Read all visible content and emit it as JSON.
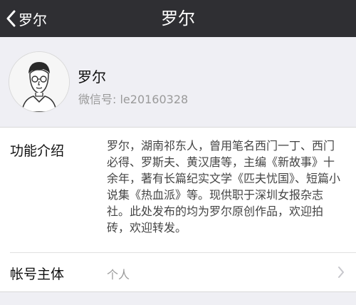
{
  "navbar": {
    "back_label": "罗尔",
    "title": "罗尔",
    "background": "#2f2f33"
  },
  "profile": {
    "name": "罗尔",
    "wechat_id": "微信号: le20160328",
    "avatar_icon": "cartoon-portrait-avatar"
  },
  "info": {
    "intro_label": "功能介绍",
    "intro_text": "罗尔，湖南祁东人，曾用笔名西门一丁、西门必得、罗斯夫、黄汉唐等，主编《新故事》十余年，著有长篇纪实文学《匹夫忧国》、短篇小说集《热血派》等。现供职于深圳女报杂志社。此处发布的均为罗尔原创作品，欢迎拍砖，欢迎转发。",
    "owner_label": "帐号主体",
    "owner_value": "个人"
  }
}
